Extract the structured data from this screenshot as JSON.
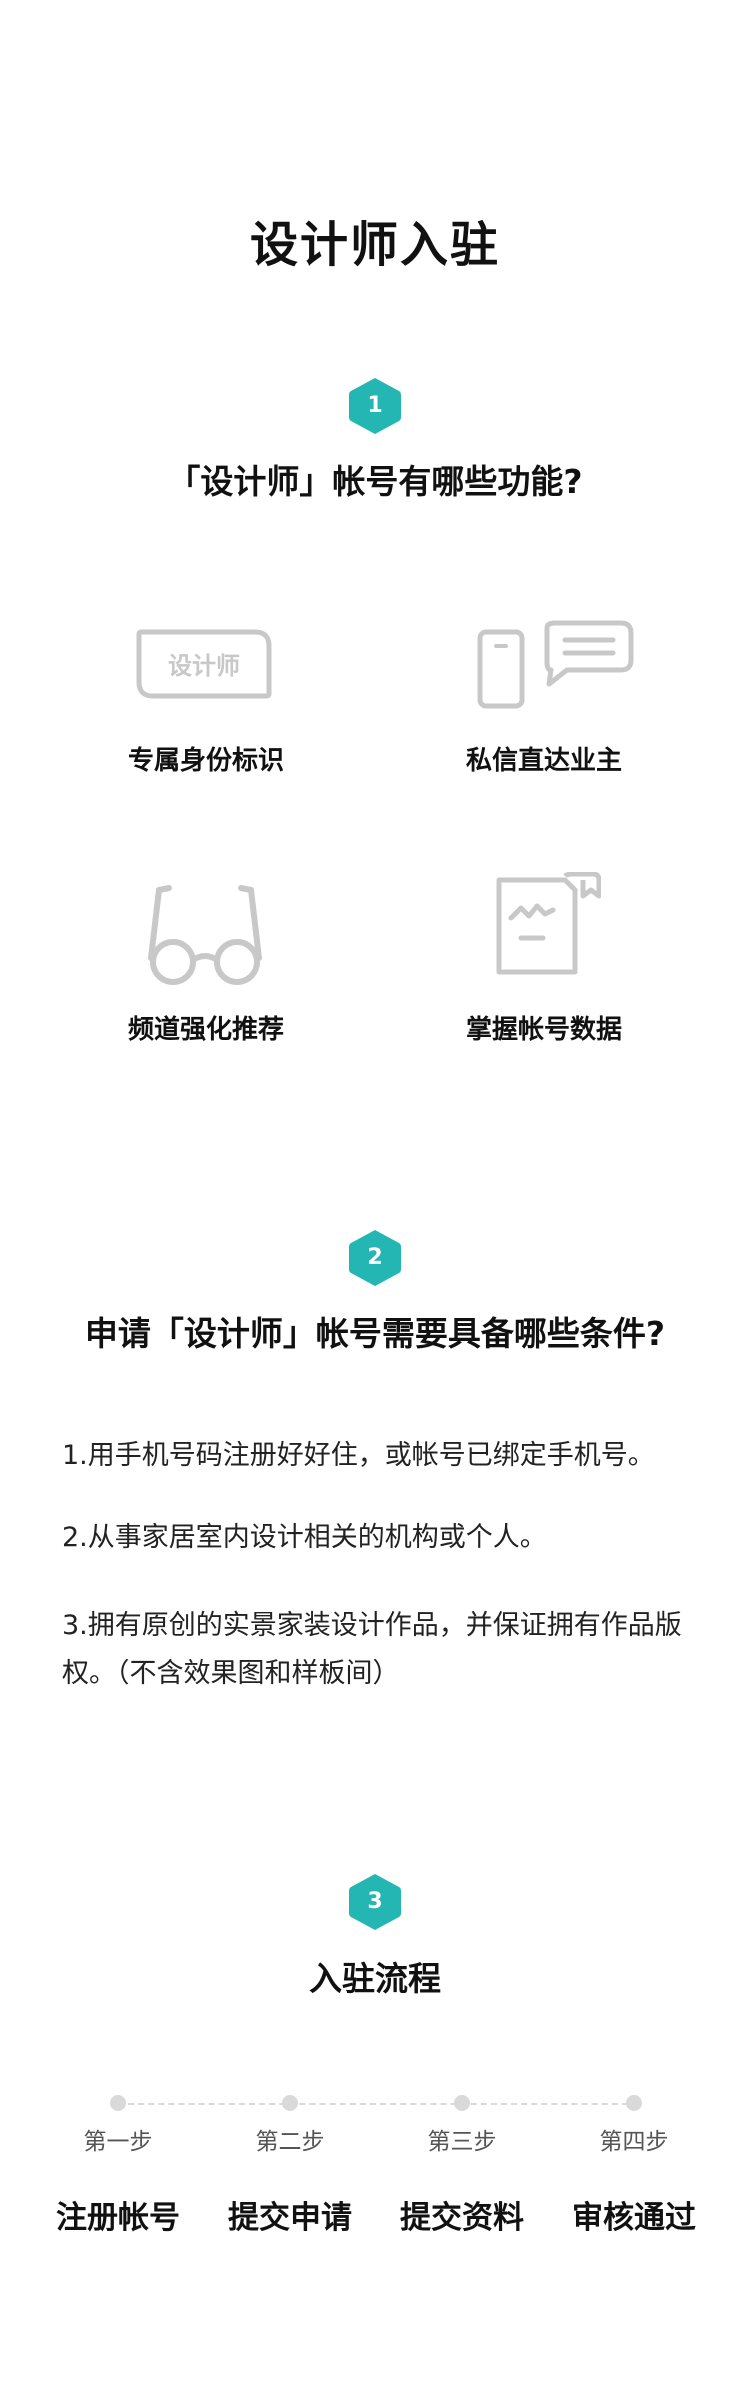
{
  "page": {
    "title": "设计师入驻"
  },
  "accent_color": "#23b6b3",
  "section1": {
    "number": "1",
    "title": "「设计师」帐号有哪些功能?",
    "features": [
      {
        "icon": "badge-card-icon",
        "icon_text": "设计师",
        "label": "专属身份标识"
      },
      {
        "icon": "phone-chat-icon",
        "label": "私信直达业主"
      },
      {
        "icon": "glasses-icon",
        "label": "频道强化推荐"
      },
      {
        "icon": "document-chart-icon",
        "label": "掌握帐号数据"
      }
    ]
  },
  "section2": {
    "number": "2",
    "title": "申请「设计师」帐号需要具备哪些条件?",
    "conditions": [
      "1.用手机号码注册好好住，或帐号已绑定手机号。",
      "2.从事家居室内设计相关的机构或个人。",
      "3.拥有原创的实景家装设计作品，并保证拥有作品版权。（不含效果图和样板间）"
    ]
  },
  "section3": {
    "number": "3",
    "title": "入驻流程",
    "steps": [
      {
        "num": "第一步",
        "name": "注册帐号"
      },
      {
        "num": "第二步",
        "name": "提交申请"
      },
      {
        "num": "第三步",
        "name": "提交资料"
      },
      {
        "num": "第四步",
        "name": "审核通过"
      }
    ]
  }
}
